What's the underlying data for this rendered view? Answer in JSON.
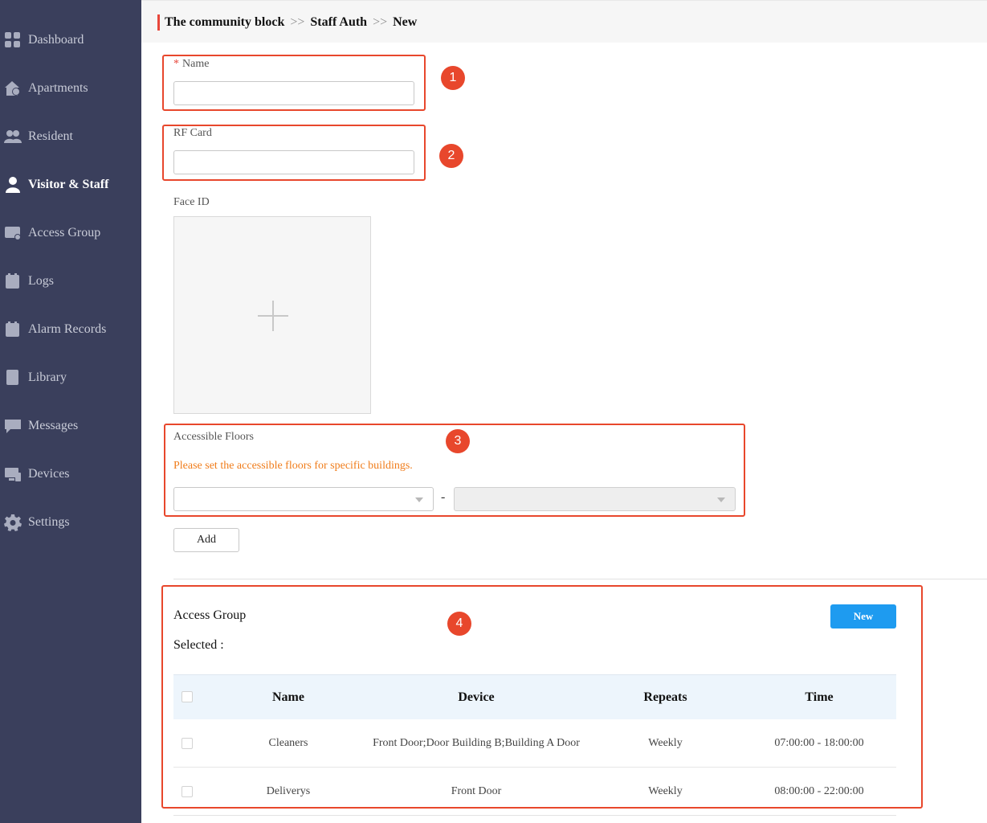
{
  "sidebar": {
    "items": [
      {
        "label": "Dashboard",
        "icon": "dashboard-icon"
      },
      {
        "label": "Apartments",
        "icon": "apartments-icon"
      },
      {
        "label": "Resident",
        "icon": "resident-icon"
      },
      {
        "label": "Visitor & Staff",
        "icon": "visitor-staff-icon",
        "active": true
      },
      {
        "label": "Access Group",
        "icon": "access-group-icon"
      },
      {
        "label": "Logs",
        "icon": "logs-icon"
      },
      {
        "label": "Alarm Records",
        "icon": "alarm-records-icon"
      },
      {
        "label": "Library",
        "icon": "library-icon"
      },
      {
        "label": "Messages",
        "icon": "messages-icon"
      },
      {
        "label": "Devices",
        "icon": "devices-icon"
      },
      {
        "label": "Settings",
        "icon": "settings-icon"
      }
    ]
  },
  "breadcrumb": {
    "part1": "The community block",
    "sep1": ">>",
    "part2": "Staff Auth",
    "sep2": ">>",
    "part3": "New"
  },
  "form": {
    "name_required_mark": "*",
    "name_label": "Name",
    "name_value": "",
    "rfcard_label": "RF Card",
    "rfcard_value": "",
    "faceid_label": "Face ID",
    "floors_label": "Accessible Floors",
    "floors_hint": "Please set the accessible floors for specific buildings.",
    "floors_separator": "-",
    "add_button": "Add"
  },
  "annotations": [
    "1",
    "2",
    "3",
    "4"
  ],
  "access_group": {
    "title": "Access Group",
    "selected_label": "Selected :",
    "new_button": "New",
    "columns": [
      "Name",
      "Device",
      "Repeats",
      "Time"
    ],
    "rows": [
      {
        "name": "Cleaners",
        "device": "Front Door;Door Building B;Building A Door",
        "repeats": "Weekly",
        "time": "07:00:00 - 18:00:00"
      },
      {
        "name": "Deliverys",
        "device": "Front Door",
        "repeats": "Weekly",
        "time": "08:00:00 - 22:00:00"
      }
    ]
  },
  "colors": {
    "sidebar_bg": "#3a3f5c",
    "accent_blue": "#1e9bf0",
    "annotation_red": "#e8472c",
    "hint_orange": "#f07c1a"
  }
}
